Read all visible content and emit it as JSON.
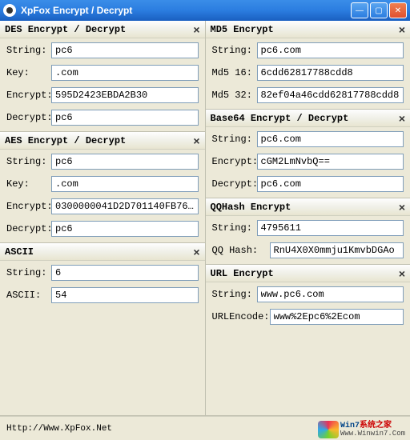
{
  "window": {
    "title": "XpFox Encrypt / Decrypt"
  },
  "left": {
    "des": {
      "title": "DES  Encrypt / Decrypt",
      "string_label": "String:",
      "string": "pc6",
      "key_label": "Key:",
      "key": ".com",
      "encrypt_label": "Encrypt:",
      "encrypt": "595D2423EBDA2B30",
      "decrypt_label": "Decrypt:",
      "decrypt": "pc6"
    },
    "aes": {
      "title": "AES  Encrypt / Decrypt",
      "string_label": "String:",
      "string": "pc6",
      "key_label": "Key:",
      "key": ".com",
      "encrypt_label": "Encrypt:",
      "encrypt": "0300000041D2D701140FB76…",
      "decrypt_label": "Decrypt:",
      "decrypt": "pc6"
    },
    "ascii": {
      "title": "ASCII",
      "string_label": "String:",
      "string": "6",
      "ascii_label": "ASCII:",
      "ascii": "54"
    }
  },
  "right": {
    "md5": {
      "title": "MD5 Encrypt",
      "string_label": "String:",
      "string": "pc6.com",
      "md516_label": "Md5 16:",
      "md516": "6cdd62817788cdd8",
      "md532_label": "Md5 32:",
      "md532": "82ef04a46cdd62817788cdd8"
    },
    "base64": {
      "title": "Base64  Encrypt / Decrypt",
      "string_label": "String:",
      "string": "pc6.com",
      "encrypt_label": "Encrypt:",
      "encrypt": "cGM2LmNvbQ==",
      "decrypt_label": "Decrypt:",
      "decrypt": "pc6.com"
    },
    "qqhash": {
      "title": "QQHash Encrypt",
      "string_label": "String:",
      "string": "4795611",
      "hash_label": "QQ Hash:",
      "hash": "RnU4X0X0mmju1KmvbDGAo"
    },
    "url": {
      "title": "URL Encrypt",
      "string_label": "String:",
      "string": "www.pc6.com",
      "encode_label": "URLEncode:",
      "encode": "www%2Epc6%2Ecom"
    }
  },
  "status": {
    "url": "Http://Www.XpFox.Net"
  },
  "watermark": {
    "brand1": "Win7",
    "brand2": "系统之家",
    "site": "Www.Winwin7.Com"
  }
}
